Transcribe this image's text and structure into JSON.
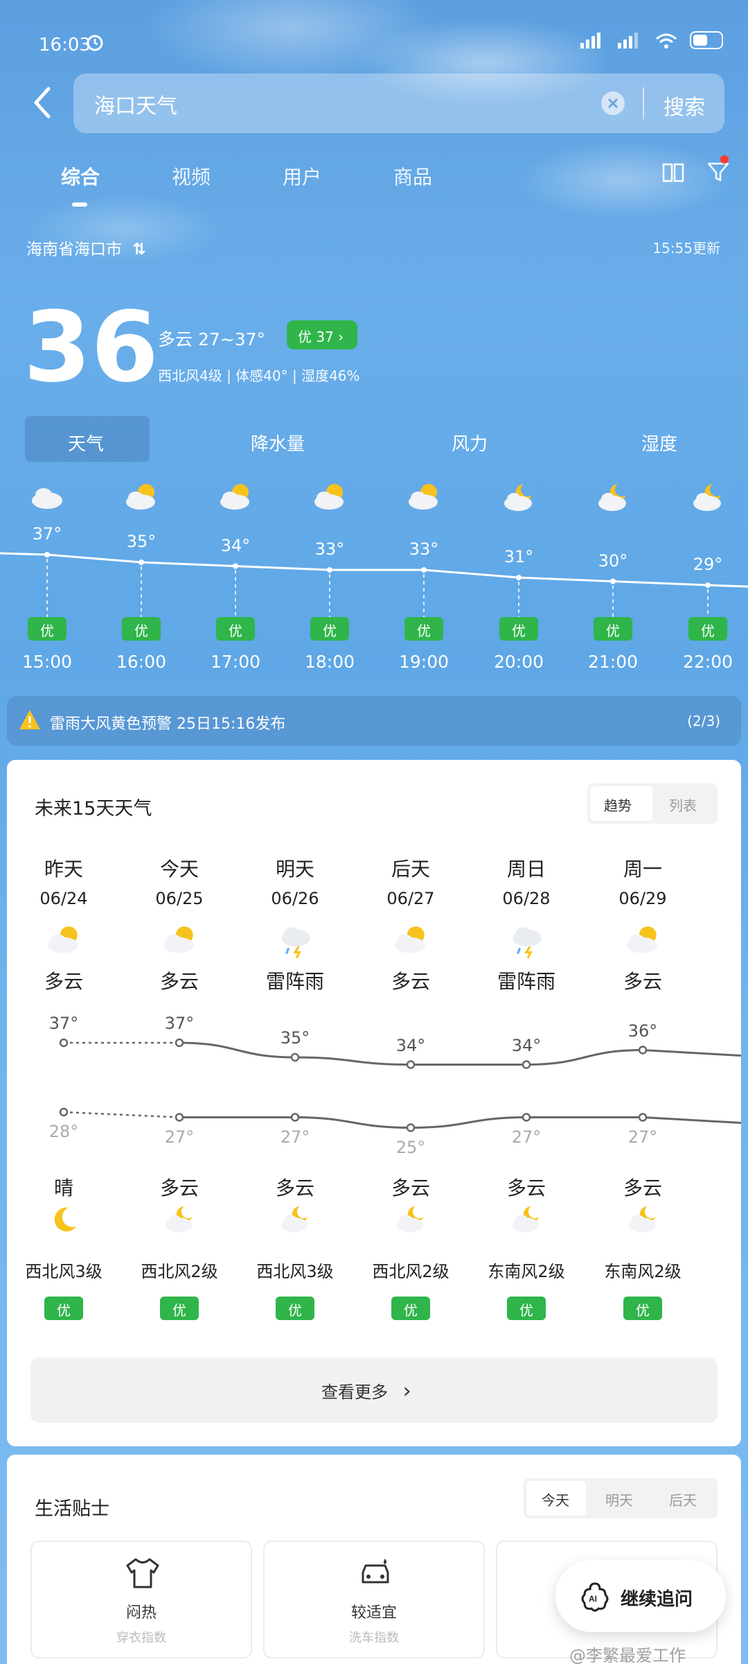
{
  "status_bar": {
    "time": "16:03"
  },
  "search": {
    "query": "海口天气",
    "button": "搜索"
  },
  "tabs": [
    "综合",
    "视频",
    "用户",
    "商品"
  ],
  "location": {
    "name": "海南省海口市",
    "update": "15:55更新"
  },
  "current": {
    "temp": "36",
    "degree": "°",
    "condition": "多云  27~37°",
    "aqi": "优 37",
    "details": "西北风4级 | 体感40° | 湿度46%"
  },
  "hourly_tabs": [
    "天气",
    "降水量",
    "风力",
    "湿度"
  ],
  "hourly": [
    {
      "temp": "37°",
      "aqi": "优",
      "time": "15:00",
      "icon": "cloudy-day-icon"
    },
    {
      "temp": "35°",
      "aqi": "优",
      "time": "16:00",
      "icon": "partly-cloudy-icon"
    },
    {
      "temp": "34°",
      "aqi": "优",
      "time": "17:00",
      "icon": "partly-cloudy-icon"
    },
    {
      "temp": "33°",
      "aqi": "优",
      "time": "18:00",
      "icon": "partly-cloudy-icon"
    },
    {
      "temp": "33°",
      "aqi": "优",
      "time": "19:00",
      "icon": "partly-cloudy-icon"
    },
    {
      "temp": "31°",
      "aqi": "优",
      "time": "20:00",
      "icon": "cloudy-night-icon"
    },
    {
      "temp": "30°",
      "aqi": "优",
      "time": "21:00",
      "icon": "cloudy-night-icon"
    },
    {
      "temp": "29°",
      "aqi": "优",
      "time": "22:00",
      "icon": "cloudy-night-icon"
    }
  ],
  "alert": {
    "text": "雷雨大风黄色预警 25日15:16发布",
    "count": "(2/3)"
  },
  "forecast": {
    "title": "未来15天天气",
    "toggle": [
      "趋势",
      "列表"
    ],
    "days": [
      {
        "name": "昨天",
        "date": "06/24",
        "day_cond": "多云",
        "hi": "37°",
        "lo": "28°",
        "night_cond": "晴",
        "wind": "西北风3级",
        "aqi": "优",
        "day_icon": "partly-cloudy-icon",
        "night_icon": "moon-icon"
      },
      {
        "name": "今天",
        "date": "06/25",
        "day_cond": "多云",
        "hi": "37°",
        "lo": "27°",
        "night_cond": "多云",
        "wind": "西北风2级",
        "aqi": "优",
        "day_icon": "partly-cloudy-icon",
        "night_icon": "cloudy-night-icon"
      },
      {
        "name": "明天",
        "date": "06/26",
        "day_cond": "雷阵雨",
        "hi": "35°",
        "lo": "27°",
        "night_cond": "多云",
        "wind": "西北风3级",
        "aqi": "优",
        "day_icon": "thunderstorm-icon",
        "night_icon": "cloudy-night-icon"
      },
      {
        "name": "后天",
        "date": "06/27",
        "day_cond": "多云",
        "hi": "34°",
        "lo": "25°",
        "night_cond": "多云",
        "wind": "西北风2级",
        "aqi": "优",
        "day_icon": "partly-cloudy-icon",
        "night_icon": "cloudy-night-icon"
      },
      {
        "name": "周日",
        "date": "06/28",
        "day_cond": "雷阵雨",
        "hi": "34°",
        "lo": "27°",
        "night_cond": "多云",
        "wind": "东南风2级",
        "aqi": "优",
        "day_icon": "thunderstorm-icon",
        "night_icon": "cloudy-night-icon"
      },
      {
        "name": "周一",
        "date": "06/29",
        "day_cond": "多云",
        "hi": "36°",
        "lo": "27°",
        "night_cond": "多云",
        "wind": "东南风2级",
        "aqi": "优",
        "day_icon": "partly-cloudy-icon",
        "night_icon": "cloudy-night-icon"
      }
    ],
    "more": "查看更多"
  },
  "life": {
    "title": "生活贴士",
    "toggle": [
      "今天",
      "明天",
      "后天"
    ],
    "items": [
      {
        "label": "闷热",
        "sub": "穿衣指数",
        "icon": "tshirt-icon"
      },
      {
        "label": "较适宜",
        "sub": "洗车指数",
        "icon": "car-wash-icon"
      }
    ]
  },
  "fab": {
    "label": "继续追问"
  },
  "watermark": "@李繁最爱工作"
}
